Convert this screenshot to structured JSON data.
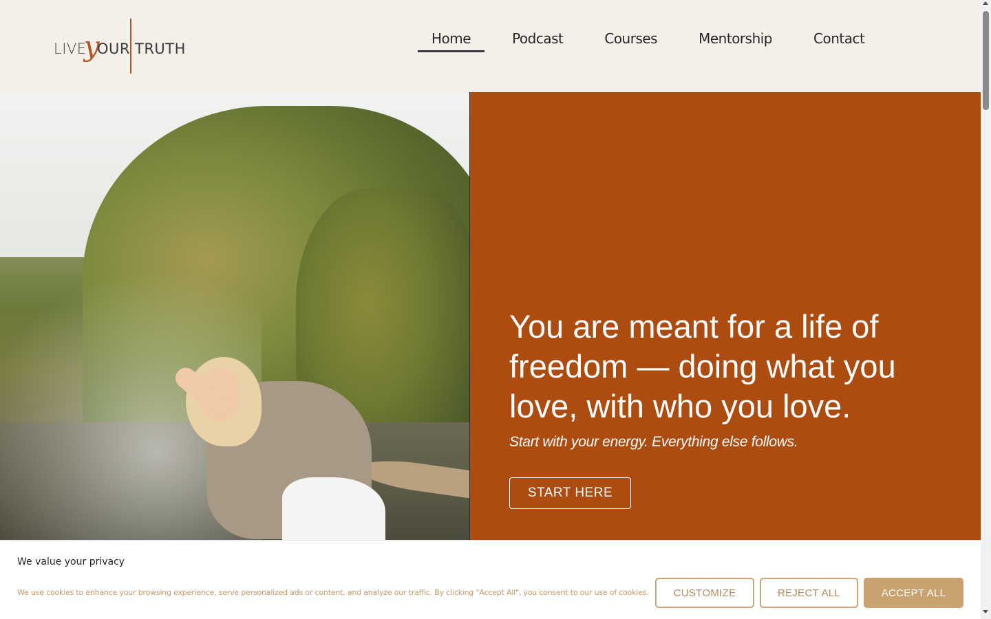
{
  "logo": {
    "part1": "LIVE",
    "part_y": "y",
    "part2": "OUR",
    "part3": "TRUTH"
  },
  "nav": {
    "items": [
      {
        "label": "Home",
        "active": true
      },
      {
        "label": "Podcast",
        "active": false
      },
      {
        "label": "Courses",
        "active": false
      },
      {
        "label": "Mentorship",
        "active": false
      },
      {
        "label": "Contact",
        "active": false
      }
    ]
  },
  "hero": {
    "title": "You are meant for a life of freedom — doing what you love, with who you love.",
    "subtitle": "Start with your energy. Everything else follows.",
    "cta_label": "START HERE"
  },
  "cookie": {
    "title": "We value your privacy",
    "text": "We use cookies to enhance your browsing experience, serve personalized ads or content, and analyze our traffic. By clicking \"Accept All\", you consent to our use of cookies.",
    "customize_label": "CUSTOMIZE",
    "reject_label": "REJECT ALL",
    "accept_label": "ACCEPT ALL"
  },
  "colors": {
    "header_bg": "#f5efe9",
    "accent_rust": "#ad4c11",
    "cookie_gold": "#c9a26f"
  }
}
